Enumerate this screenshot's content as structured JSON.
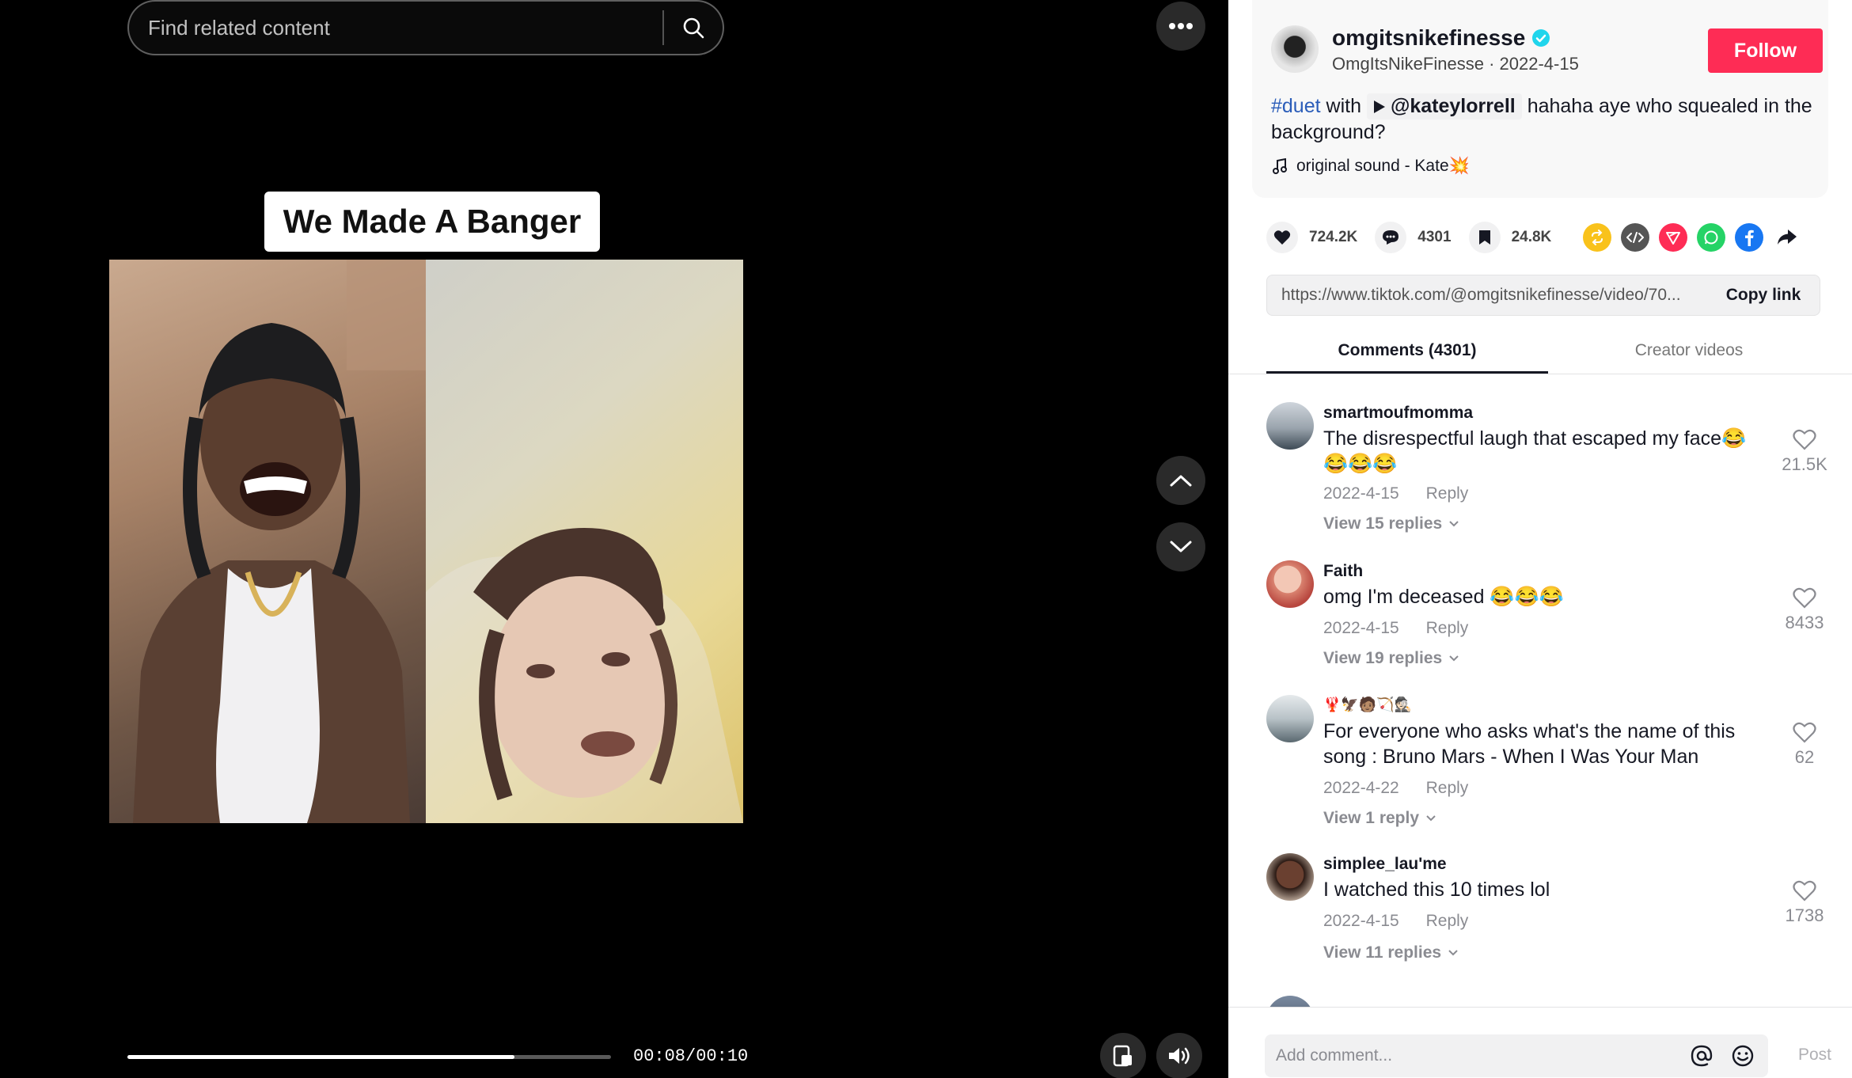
{
  "search": {
    "placeholder": "Find related content"
  },
  "video": {
    "caption": "We Made A Banger",
    "progress": 0.8,
    "time": "00:08/00:10"
  },
  "author": {
    "username": "omgitsnikefinesse",
    "display_name": "OmgItsNikeFinesse",
    "date": "2022-4-15",
    "verified": true,
    "follow_label": "Follow"
  },
  "description": {
    "hashtag": "#duet",
    "with_word": "with",
    "mention": "@kateylorrell",
    "text": "hahaha aye who squealed in the background?",
    "music": "original sound - Kate💥"
  },
  "stats": {
    "likes": "724.2K",
    "comments": "4301",
    "saves": "24.8K"
  },
  "share": {
    "icons": [
      "repost-icon",
      "embed-icon",
      "send-icon",
      "whatsapp-icon",
      "facebook-icon",
      "share-arrow-icon"
    ],
    "colors": [
      "#f9c21b",
      "#555555",
      "#fe2c55",
      "#25d366",
      "#1877f2",
      "#161823"
    ]
  },
  "link": {
    "url": "https://www.tiktok.com/@omgitsnikefinesse/video/70...",
    "copy_label": "Copy link"
  },
  "tabs": [
    {
      "label": "Comments (4301)",
      "active": true
    },
    {
      "label": "Creator videos",
      "active": false
    }
  ],
  "comments": [
    {
      "user": "smartmoufmomma",
      "text": "The disrespectful laugh that escaped my face😂😂😂😂",
      "date": "2022-4-15",
      "reply_label": "Reply",
      "view_replies": "View 15 replies",
      "likes": "21.5K"
    },
    {
      "user": "Faith",
      "text": "omg I'm deceased 😂😂😂",
      "date": "2022-4-15",
      "reply_label": "Reply",
      "view_replies": "View 19 replies",
      "likes": "8433"
    },
    {
      "user": "🦞🦅🧑🏽🏹🕵🏻",
      "text": "For everyone who asks what's the name of this song : Bruno Mars - When I Was Your Man",
      "date": "2022-4-22",
      "reply_label": "Reply",
      "view_replies": "View 1 reply",
      "likes": "62"
    },
    {
      "user": "simplee_lau'me",
      "text": "I watched this 10 times lol",
      "date": "2022-4-15",
      "reply_label": "Reply",
      "view_replies": "View 11 replies",
      "likes": "1738"
    }
  ],
  "comment_input": {
    "placeholder": "Add comment...",
    "post_label": "Post"
  }
}
